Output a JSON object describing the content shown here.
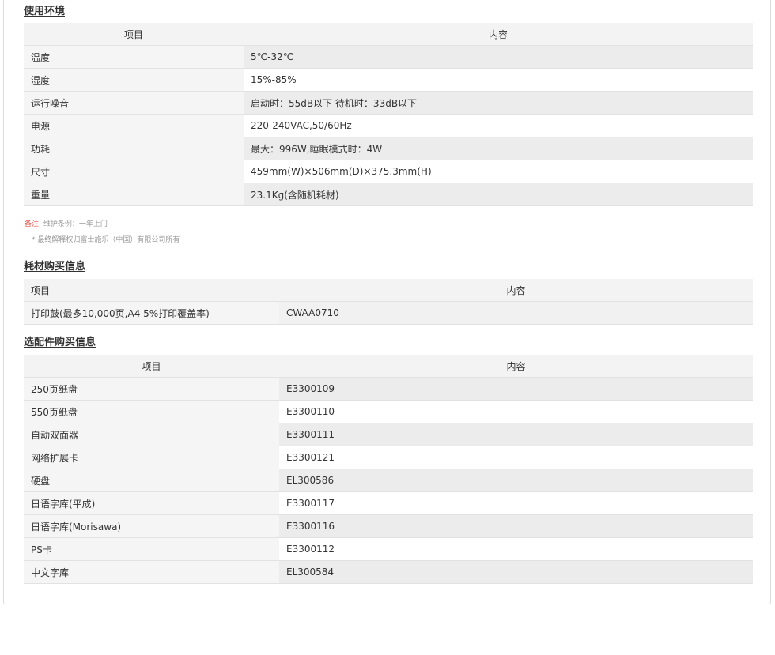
{
  "env": {
    "title": "使用环境",
    "header": {
      "item": "项目",
      "content": "内容"
    },
    "rows": [
      {
        "label": "温度",
        "value": "5℃-32℃"
      },
      {
        "label": "湿度",
        "value": "15%-85%"
      },
      {
        "label": "运行噪音",
        "value": "启动时：55dB以下 待机时：33dB以下"
      },
      {
        "label": "电源",
        "value": "220-240VAC,50/60Hz"
      },
      {
        "label": "功耗",
        "value": "最大：996W,睡眠模式时：4W"
      },
      {
        "label": "尺寸",
        "value": "459mm(W)×506mm(D)×375.3mm(H)"
      },
      {
        "label": "重量",
        "value": "23.1Kg(含随机耗材)"
      }
    ]
  },
  "notes": {
    "remark_label": "备注:",
    "remark_text": "维护条例：一年上门",
    "footnote": "* 最终解释权归富士施乐（中国）有限公司所有"
  },
  "consumables": {
    "title": "耗材购买信息",
    "header": {
      "item": "项目",
      "content": "内容"
    },
    "rows": [
      {
        "label": "打印鼓(最多10,000页,A4 5%打印覆盖率)",
        "value": "CWAA0710"
      }
    ]
  },
  "options": {
    "title": "选配件购买信息",
    "header": {
      "item": "项目",
      "content": "内容"
    },
    "rows": [
      {
        "label": "250页纸盘",
        "value": "E3300109"
      },
      {
        "label": "550页纸盘",
        "value": "E3300110"
      },
      {
        "label": "自动双面器",
        "value": "E3300111"
      },
      {
        "label": "网络扩展卡",
        "value": "E3300121"
      },
      {
        "label": "硬盘",
        "value": "EL300586"
      },
      {
        "label": "日语字库(平成)",
        "value": "E3300117"
      },
      {
        "label": "日语字库(Morisawa)",
        "value": "E3300116"
      },
      {
        "label": "PS卡",
        "value": "E3300112"
      },
      {
        "label": "中文字库",
        "value": "EL300584"
      }
    ]
  }
}
